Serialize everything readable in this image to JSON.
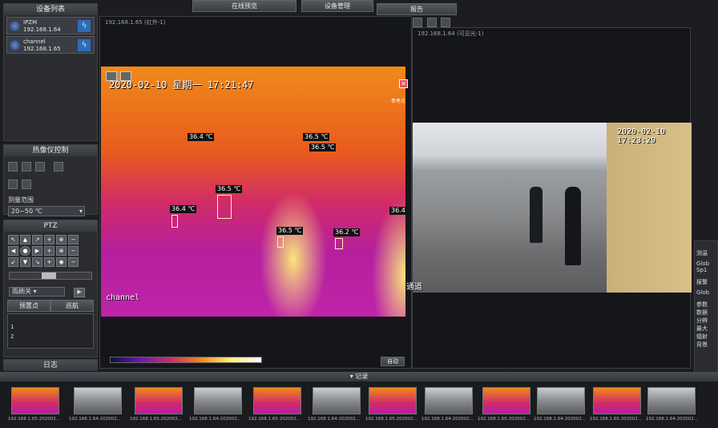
{
  "device_list": {
    "title": "设备列表",
    "devices": [
      {
        "name": "IPZM",
        "ip": "192.168.1.64"
      },
      {
        "name": "channel",
        "ip": "192.168.1.65"
      }
    ]
  },
  "thermal_control": {
    "title": "热像仪控制",
    "range_label": "测量范围",
    "range_value": "20~50 ℃"
  },
  "ptz": {
    "title": "PTZ",
    "mode_select": "雨刷关",
    "preset_tab": "预置点",
    "cruise_tab": "巡航",
    "list_rows": [
      "1",
      "2"
    ]
  },
  "log": {
    "title": "日志"
  },
  "top_tabs": {
    "live": "在线预览",
    "device_mgmt": "设备管理",
    "report": "报告"
  },
  "left_view": {
    "title": "192.168.1.65 (红外-1)",
    "osd_time": "2020-02-10 星期一 17:21:47",
    "osd_channel": "channel",
    "alarm_label": "参考点",
    "readings": [
      "36.4 ℃",
      "36.5 ℃",
      "36.5 ℃",
      "36.5 ℃",
      "36.4 ℃",
      "36.5 ℃",
      "36.2 ℃",
      "36.4"
    ],
    "auto_btn": "自动"
  },
  "right_view": {
    "title": "192.168.1.64 (可见光-1)",
    "osd_time": "2020-02-10 17:23:29",
    "osd_label": "通道"
  },
  "right_side": {
    "labels": [
      "测温",
      "Glob",
      "Sp1",
      "报警",
      "Glob",
      "参数",
      "数据",
      "分辨",
      "最大",
      "辐射",
      "背景"
    ]
  },
  "records": {
    "title": "▾ 记录",
    "items": [
      "192.168.1.65-202002...",
      "192.168.1.64-202002...",
      "192.168.1.65-202002...",
      "192.168.1.64-202002...",
      "192.168.1.65-202002...",
      "192.168.1.64-202002...",
      "192.168.1.65-202002...",
      "192.168.1.64-202002...",
      "192.168.1.65-202002...",
      "192.168.1.64-202002...",
      "192.168.1.65-202002...",
      "192.168.1.64-202002..."
    ]
  },
  "colors": {
    "accent": "#2e6cb8",
    "thermal_hot": "#fff07a",
    "thermal_cold": "#b51fa0"
  }
}
